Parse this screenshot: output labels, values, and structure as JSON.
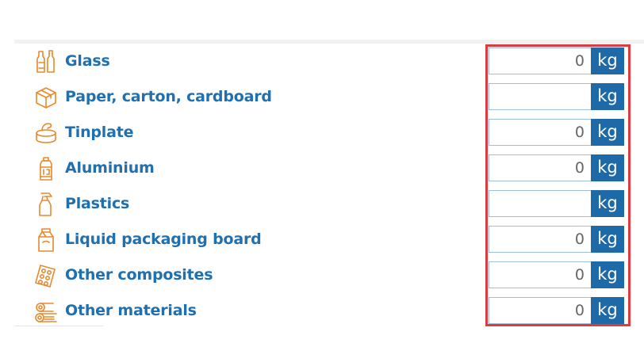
{
  "materials": [
    {
      "label": "Glass",
      "icon": "glass-bottles-icon",
      "value": "0",
      "unit": "kg"
    },
    {
      "label": "Paper, carton, cardboard",
      "icon": "cardboard-box-icon",
      "value": "",
      "unit": "kg"
    },
    {
      "label": "Tinplate",
      "icon": "tin-can-icon",
      "value": "0",
      "unit": "kg"
    },
    {
      "label": "Aluminium",
      "icon": "aerosol-can-icon",
      "value": "0",
      "unit": "kg"
    },
    {
      "label": "Plastics",
      "icon": "spray-bottle-icon",
      "value": "",
      "unit": "kg"
    },
    {
      "label": "Liquid packaging board",
      "icon": "milk-carton-icon",
      "value": "0",
      "unit": "kg"
    },
    {
      "label": "Other composites",
      "icon": "blister-pack-icon",
      "value": "0",
      "unit": "kg"
    },
    {
      "label": "Other materials",
      "icon": "mixed-materials-icon",
      "value": "0",
      "unit": "kg"
    }
  ],
  "colors": {
    "label": "#2070b0",
    "unit_background": "#1e6aa8",
    "icon": "#e8892c",
    "highlight_border": "#e0393e"
  }
}
